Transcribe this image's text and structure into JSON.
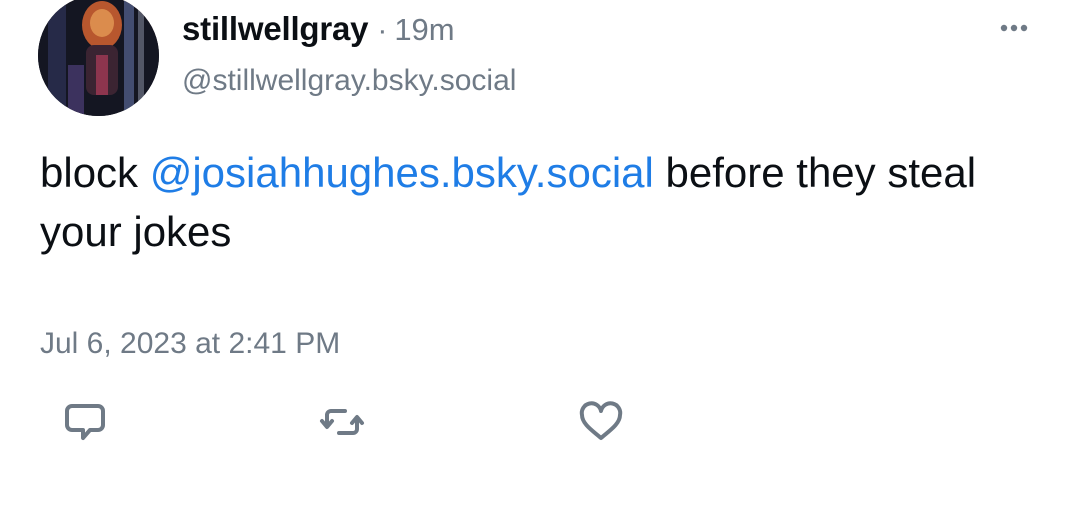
{
  "post": {
    "author": {
      "display_name": "stillwellgray",
      "separator": "·",
      "time_ago": "19m",
      "handle": "@stillwellgray.bsky.social"
    },
    "text": {
      "before_mention": "block ",
      "mention": "@josiahhughes.bsky.social",
      "after_mention": " before they steal your jokes"
    },
    "timestamp": "Jul 6, 2023 at 2:41 PM"
  },
  "icons": {
    "more": "more-horizontal-icon",
    "reply": "reply-bubble-icon",
    "repost": "repost-icon",
    "like": "heart-icon"
  },
  "colors": {
    "mention": "#1f7de6",
    "muted_text": "#6f7a86",
    "icon": "#6f7a86",
    "body_text": "#0b0f14"
  }
}
